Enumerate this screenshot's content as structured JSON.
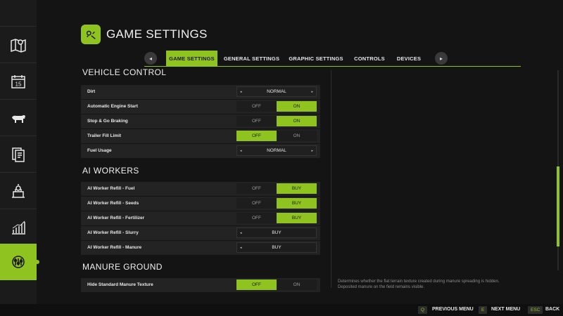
{
  "accent_color": "#8fc31f",
  "sidebar": {
    "items": [
      {
        "icon": "map-icon"
      },
      {
        "icon": "calendar-icon",
        "text": "15"
      },
      {
        "icon": "animals-icon"
      },
      {
        "icon": "contracts-icon"
      },
      {
        "icon": "production-icon"
      },
      {
        "icon": "statistics-icon"
      },
      {
        "icon": "settings-icon",
        "active": true
      }
    ]
  },
  "header": {
    "title": "GAME SETTINGS",
    "icon": "settings-gear-icon"
  },
  "tabs": {
    "prev_arrow": "◂",
    "next_arrow": "▸",
    "items": [
      {
        "label": "GAME SETTINGS",
        "active": true
      },
      {
        "label": "GENERAL SETTINGS"
      },
      {
        "label": "GRAPHIC SETTINGS"
      },
      {
        "label": "CONTROLS"
      },
      {
        "label": "DEVICES"
      }
    ]
  },
  "sections": {
    "vehicle_control": {
      "title": "VEHICLE CONTROL",
      "rows": [
        {
          "label": "Dirt",
          "type": "select",
          "value": "NORMAL"
        },
        {
          "label": "Automatic Engine Start",
          "type": "toggle",
          "off": "OFF",
          "on": "ON",
          "state": "on"
        },
        {
          "label": "Stop & Go Braking",
          "type": "toggle",
          "off": "OFF",
          "on": "ON",
          "state": "on"
        },
        {
          "label": "Trailer Fill Limit",
          "type": "toggle",
          "off": "OFF",
          "on": "ON",
          "state": "off"
        },
        {
          "label": "Fuel Usage",
          "type": "select",
          "value": "NORMAL"
        }
      ]
    },
    "ai_workers": {
      "title": "AI WORKERS",
      "rows": [
        {
          "label": "AI Worker Refill - Fuel",
          "type": "toggle",
          "off": "OFF",
          "on": "BUY",
          "state": "on"
        },
        {
          "label": "AI Worker Refill - Seeds",
          "type": "toggle",
          "off": "OFF",
          "on": "BUY",
          "state": "on"
        },
        {
          "label": "AI Worker Refill - Fertilizer",
          "type": "toggle",
          "off": "OFF",
          "on": "BUY",
          "state": "on"
        },
        {
          "label": "AI Worker Refill - Slurry",
          "type": "button",
          "value": "BUY"
        },
        {
          "label": "AI Worker Refill - Manure",
          "type": "button",
          "value": "BUY"
        }
      ]
    },
    "manure_ground": {
      "title": "MANURE GROUND",
      "rows": [
        {
          "label": "Hide Standard Manure Texture",
          "type": "toggle",
          "off": "OFF",
          "on": "ON",
          "state": "off"
        }
      ]
    }
  },
  "description": "Determines whether the flat terrain texture created during manure spreading is hidden. Deposited manure on the field remains visible.",
  "footer": {
    "items": [
      {
        "key": "Q",
        "label": "PREVIOUS MENU"
      },
      {
        "key": "E",
        "label": "NEXT MENU"
      },
      {
        "key": "ESC",
        "label": "BACK"
      }
    ]
  }
}
